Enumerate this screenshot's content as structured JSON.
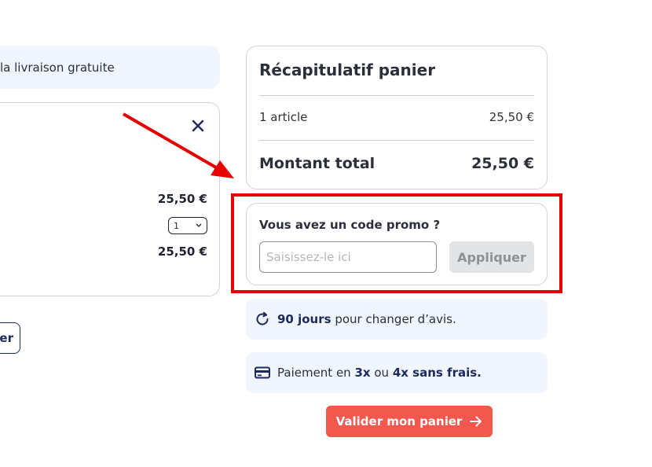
{
  "left": {
    "shipping_banner": "la livraison gratuite",
    "item": {
      "unit_price": "25,50 €",
      "quantity": "1",
      "line_total": "25,50 €"
    },
    "continue_button_fragment": "er"
  },
  "summary": {
    "title": "Récapitulatif panier",
    "items_label": "1 article",
    "items_value": "25,50 €",
    "total_label": "Montant total",
    "total_value": "25,50 €"
  },
  "promo": {
    "title": "Vous avez un code promo ?",
    "placeholder": "Saisissez-le ici",
    "apply_label": "Appliquer"
  },
  "info": {
    "returns": {
      "icon": "refresh-icon",
      "bold": "90 jours",
      "text": " pour changer d’avis."
    },
    "payment": {
      "icon": "credit-card-icon",
      "prefix": "Paiement en ",
      "bold1": "3x",
      "middle": " ou ",
      "bold2": "4x sans frais."
    }
  },
  "validate_label": "Valider mon panier",
  "colors": {
    "accent": "#f2584e",
    "navy": "#1c2a5c",
    "annotation": "#e60000",
    "info_bg": "#f0f5fe"
  }
}
